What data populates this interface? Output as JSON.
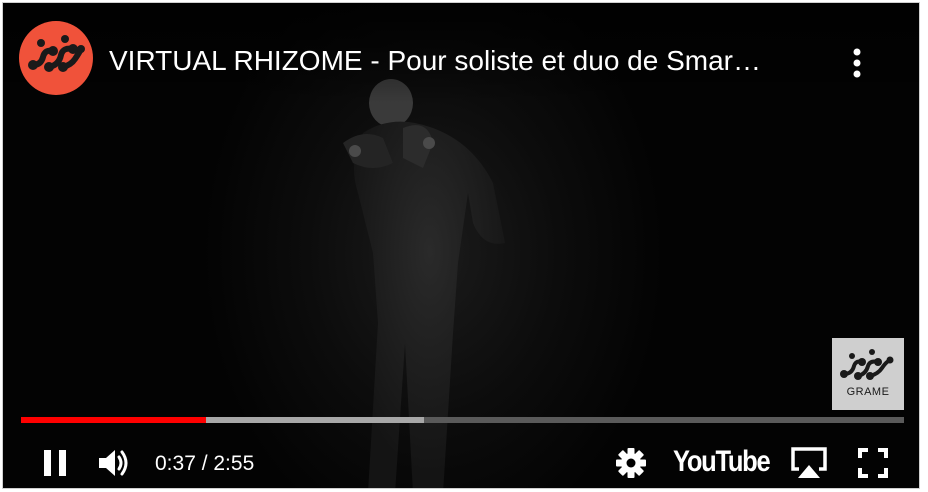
{
  "video": {
    "title": "VIRTUAL RHIZOME - Pour soliste et duo de Smar…",
    "progress_played_fraction": 0.21,
    "progress_buffered_fraction": 0.456
  },
  "channel": {
    "avatar_icon": "rhizome-logo-icon",
    "avatar_color": "#f0523a"
  },
  "watermark": {
    "label": "GRAME",
    "icon": "rhizome-logo-icon"
  },
  "controls": {
    "time_display": "0:37 / 2:55",
    "play_state_icon": "pause-icon",
    "volume_icon": "volume-icon",
    "settings_icon": "gear-icon",
    "brand_label": "YouTube",
    "airplay_icon": "airplay-icon",
    "fullscreen_icon": "fullscreen-icon"
  },
  "colors": {
    "played": "#ff0000",
    "buffered": "#a8a8a8",
    "track": "#5a5a5a"
  }
}
